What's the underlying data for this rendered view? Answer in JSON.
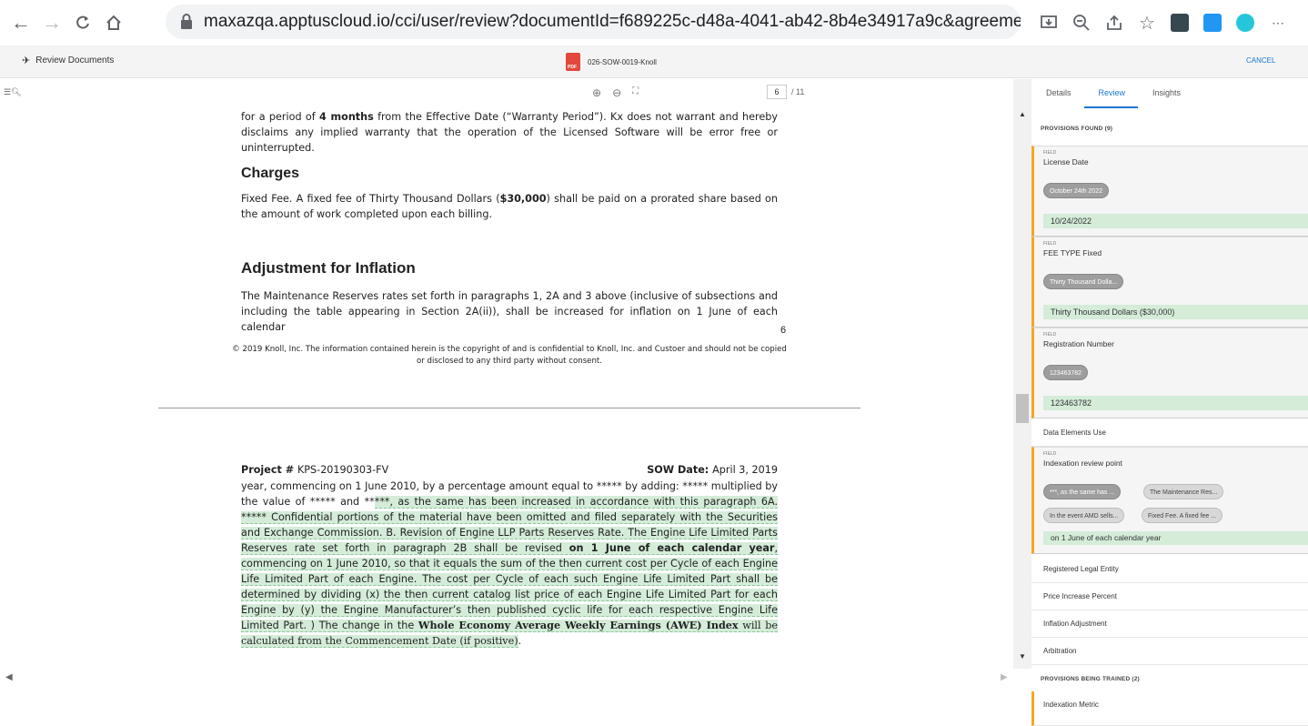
{
  "browser": {
    "url": "maxazqa.apptuscloud.io/cci/user/review?documentId=f689225c-d48a-4041-ab42-8b4e34917a9c&agreementId=..."
  },
  "header": {
    "left_label": "Review Documents",
    "doc_name": "026-SOW-0019-Knoll",
    "pdf_badge": "PDF",
    "cancel": "CANCEL"
  },
  "viewer": {
    "current_page": "6",
    "total_pages": "/ 11"
  },
  "doc": {
    "p1_a": "for a period of ",
    "p1_b": "4 months",
    "p1_c": " from the Effective Date (“Warranty Period”). Kx does not warrant and hereby disclaims any implied warranty that the operation of the Licensed Software will be error free or uninterrupted.",
    "charges_heading": "Charges",
    "p2_a": "Fixed Fee. A fixed fee of Thirty Thousand Dollars (",
    "p2_b": "$30,000",
    "p2_c": ") shall be paid on a prorated share based on the amount of work completed upon each billing.",
    "inflation_heading": "Adjustment for Inflation",
    "p3": "The Maintenance Reserves rates set forth in paragraphs 1, 2A and 3 above (inclusive of subsections and including the table appearing in Section 2A(ii)), shall be increased for inflation on 1 June of each calendar",
    "page_number": "6",
    "copyright": "© 2019 Knoll, Inc. The information contained herein is the copyright of and is confidential to Knoll, Inc. and Custoer and should not be copied or disclosed to any third party without consent.",
    "project_label": "Project # ",
    "project_value": "KPS-20190303-FV",
    "sow_label": "SOW Date: ",
    "sow_value": "April 3, 2019",
    "p4_a": "year, commencing on 1 June 2010, by a percentage amount equal to ***** by adding: ***** multiplied by the value of ***** and **",
    "p4_b": "***, as the same has been increased in accordance with this paragraph 6A. ***** Confidential portions of the material have been omitted and filed separately with the Securities and Exchange Commission. B. Revision of Engine LLP Parts Reserves Rate. The Engine Life Limited Parts Reserves rate set forth in paragraph 2B shall be revised ",
    "p4_c": "on 1 June of each calendar year",
    "p4_d": ", commencing on 1 June 2010, so that it equals the sum of the then current cost per Cycle of each Engine Life Limited Part of each Engine. The cost per Cycle of each such Engine Life Limited Part shall be determined by dividing (x) the then current catalog list price of each Engine Life Limited Part for each Engine by (y) the Engine Manufacturer’s then published cyclic life for each respective Engine Life Limited Part. ) The change in the ",
    "p4_e": "Whole Economy Average Weekly Earnings (AWE) Index",
    "p4_f": " will be calculated from the Commencement Date (if positive)",
    "p4_g": "."
  },
  "panel": {
    "tabs": [
      "Details",
      "Review",
      "Insights"
    ],
    "provisions_found": "PROVISIONS FOUND (9)",
    "field_tag": "FIELD",
    "cards": [
      {
        "name": "License Date",
        "chip": "October 24th 2022",
        "value": "10/24/2022"
      },
      {
        "name": "FEE TYPE Fixed",
        "chip": "Thirty Thousand Dolla...",
        "value": "Thirty Thousand Dollars ($30,000)"
      },
      {
        "name": "Registration Number",
        "chip": "123463782",
        "value": "123463782"
      }
    ],
    "data_elements_use": "Data Elements Use",
    "indexation": {
      "name": "Indexation review point",
      "chips": [
        "***, as the same has ...",
        "The Maintenance Res...",
        "In the event AMD sells...",
        "Fixed Fee. A fixed fee ..."
      ],
      "value": "on 1 June of each calendar year"
    },
    "rows": [
      "Registered Legal Entity",
      "Price Increase Percent",
      "Inflation Adjustment",
      "Arbitration"
    ],
    "being_trained": "PROVISIONS BEING TRAINED (2)",
    "trained_rows": [
      "Indexation Metric"
    ]
  }
}
